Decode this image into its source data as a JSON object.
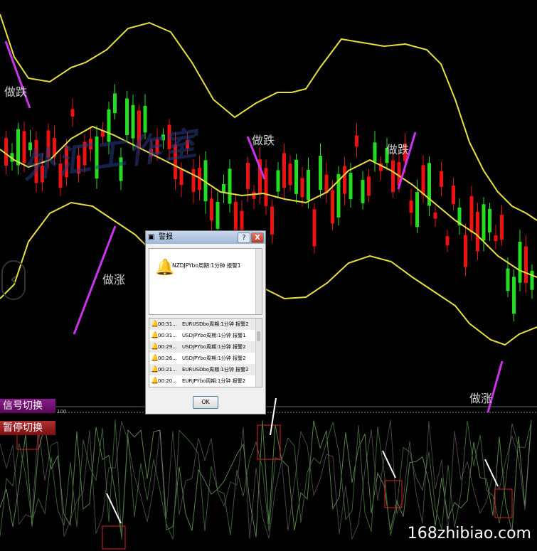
{
  "annotations": {
    "sell_1": "做跌",
    "sell_2": "做跌",
    "sell_3": "做跌",
    "buy_1": "做涨",
    "buy_2": "做涨"
  },
  "watermark": "外汇工作室",
  "buttons": {
    "signal_switch": "信号切换",
    "pause_switch": "暂停切换"
  },
  "indicator": {
    "level_label": "100"
  },
  "site_watermark": "168zhibiao.com",
  "colors": {
    "bull": "#22dd22",
    "bear": "#ee1111",
    "band": "#e8e040",
    "annotation_arrow": "#cc33ee",
    "oscillator": "#5f8f4f"
  },
  "dialog": {
    "title": "警报",
    "help_label": "?",
    "close_label": "X",
    "message": "NZDJPYbo周期:1分钟 报警1",
    "ok_label": "OK",
    "alerts": [
      {
        "time": "00:31...",
        "message": "EURUSDbo周期:1分钟 报警2"
      },
      {
        "time": "00:31...",
        "message": "USDJPYbo周期:1分钟 报警1"
      },
      {
        "time": "00:29...",
        "message": "USDJPYbo周期:1分钟 报警2"
      },
      {
        "time": "00:26...",
        "message": "USDJPYbo周期:1分钟 报警2"
      },
      {
        "time": "00:21...",
        "message": "EURUSDbo周期:1分钟 报警2"
      },
      {
        "time": "00:20...",
        "message": "EURJPYbo周期:1分钟 报警2"
      }
    ]
  }
}
